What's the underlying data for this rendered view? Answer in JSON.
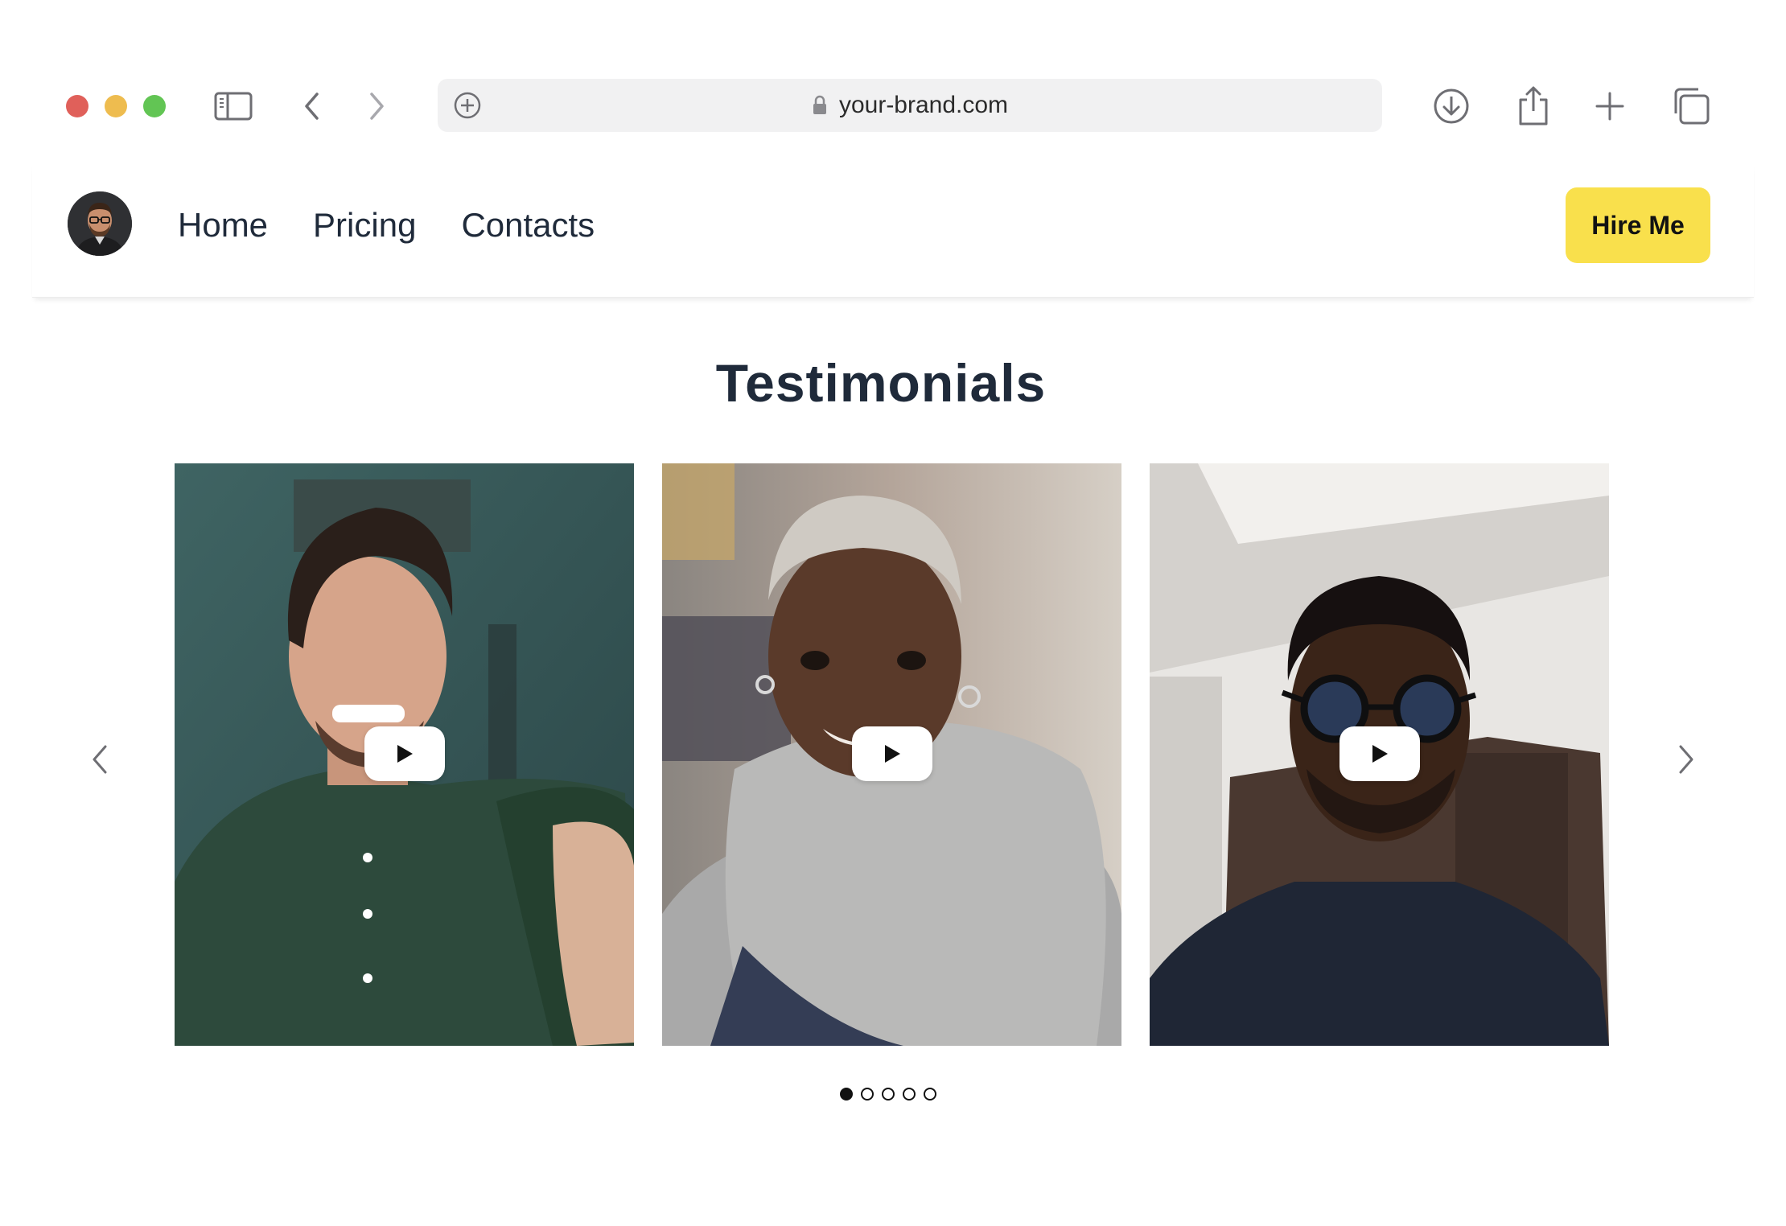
{
  "browser": {
    "url": "your-brand.com",
    "traffic_lights": [
      "#e0605a",
      "#eebc4f",
      "#62c554"
    ],
    "icons": [
      "sidebar-icon",
      "back-icon",
      "forward-icon",
      "add-icon",
      "lock-icon",
      "download-icon",
      "share-icon",
      "new-tab-icon",
      "tabs-icon"
    ]
  },
  "header": {
    "nav": [
      "Home",
      "Pricing",
      "Contacts"
    ],
    "cta_label": "Hire Me",
    "cta_color": "#f9e04c"
  },
  "main": {
    "title": "Testimonials",
    "videos": [
      {
        "subject": "smiling man in green shirt taking selfie"
      },
      {
        "subject": "smiling woman with short grey hair in grey sweater"
      },
      {
        "subject": "smiling man with round glasses in navy t-shirt"
      }
    ],
    "carousel_pages": 5,
    "carousel_active": 1
  }
}
